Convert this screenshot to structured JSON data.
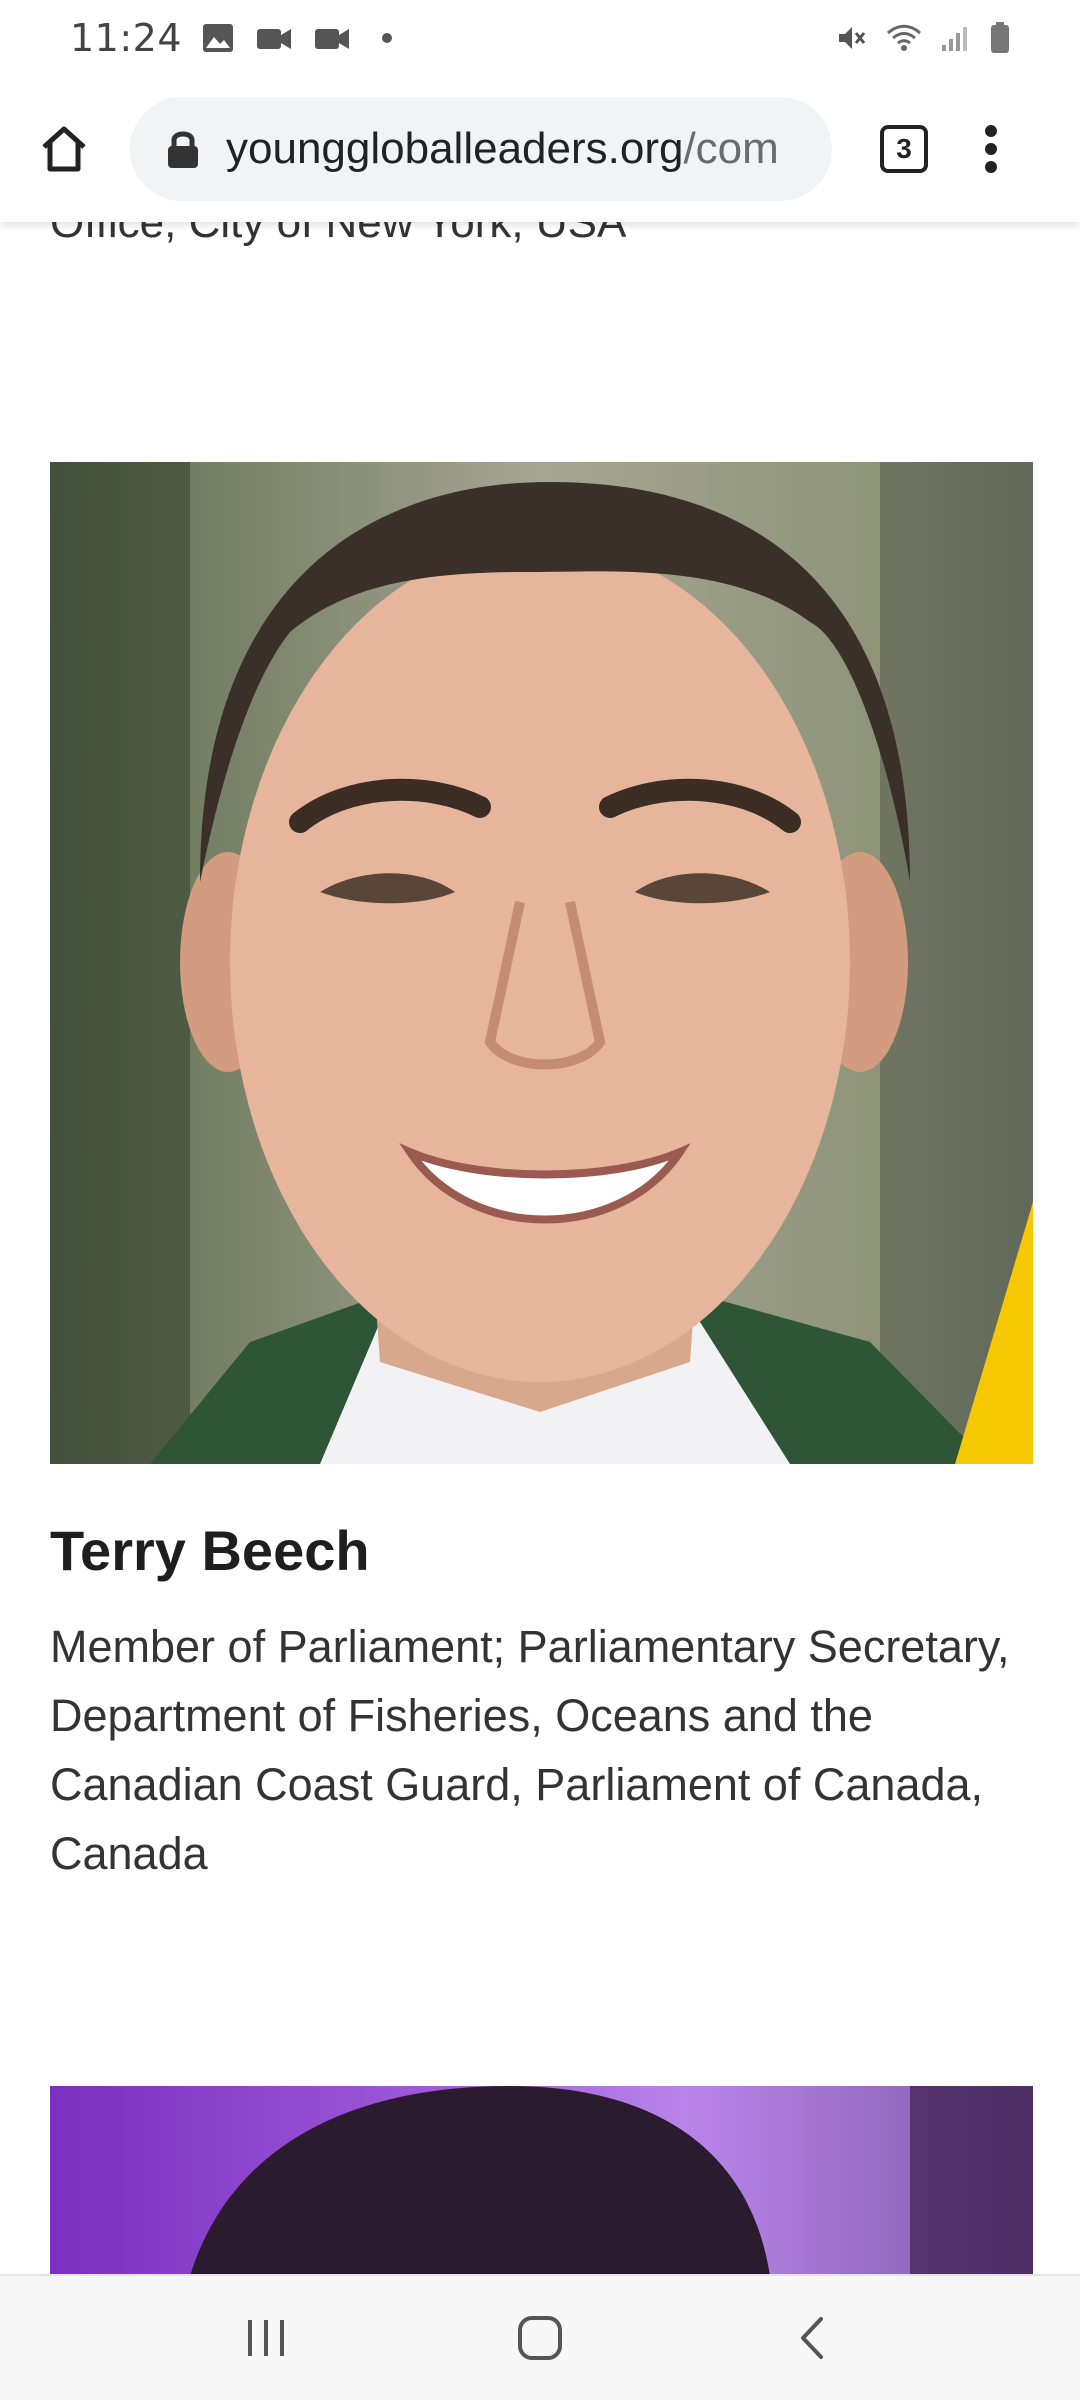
{
  "status_bar": {
    "time": "11:24",
    "left_icons": [
      "image-icon",
      "video-icon",
      "video-icon",
      "dot-icon"
    ],
    "right_icons": [
      "mute-icon",
      "wifi-icon",
      "signal-icon",
      "battery-icon"
    ]
  },
  "browser": {
    "url_domain": "younggloballeaders.org",
    "url_path": "/com",
    "tab_count": "3"
  },
  "page": {
    "previous_entry_caption": "Office, City of New York, USA",
    "profile": {
      "name": "Terry Beech",
      "title": "Member of Parliament; Parliamentary Secretary, Department of Fisheries, Oceans and the Canadian Coast Guard, Parliament of Canada, Canada"
    },
    "accent_color": "#f5c800"
  },
  "nav_bar": {
    "buttons": [
      "recents-icon",
      "home-icon",
      "back-icon"
    ]
  }
}
